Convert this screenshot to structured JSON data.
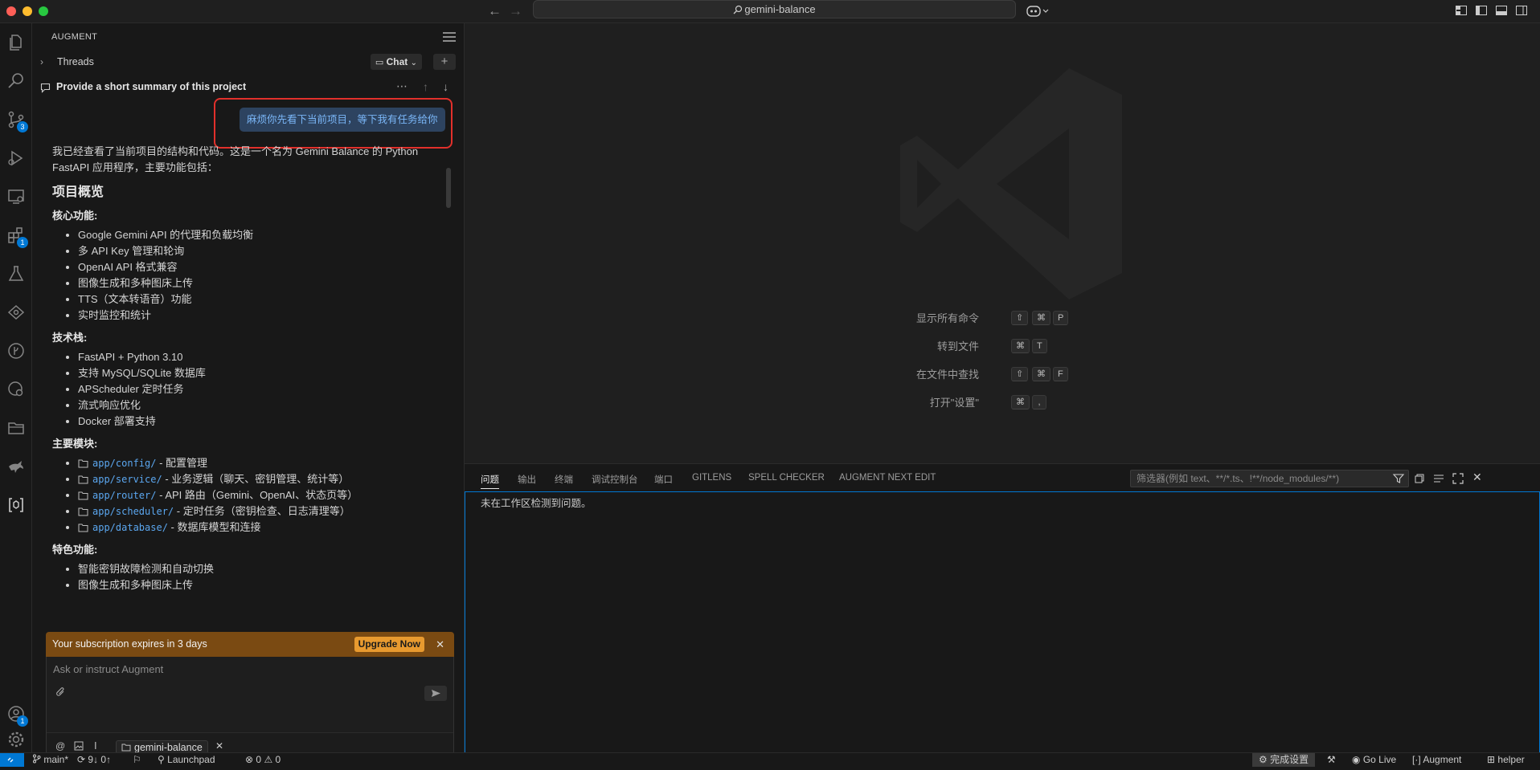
{
  "window": {
    "search_text": "gemini-balance"
  },
  "activity_bar": {
    "source_control_badge": "3",
    "extensions_badge": "1",
    "accounts_badge": "1"
  },
  "sidebar": {
    "title": "AUGMENT",
    "threads_label": "Threads",
    "chat_label": "Chat",
    "thread_title": "Provide a short summary of this project",
    "user_message": "麻烦你先看下当前项目，等下我有任务给你",
    "response": {
      "intro": "我已经查看了当前项目的结构和代码。这是一个名为 Gemini Balance 的 Python FastAPI 应用程序，主要功能包括：",
      "heading": "项目概览",
      "core_title": "核心功能:",
      "core_items": [
        "Google Gemini API 的代理和负载均衡",
        "多 API Key 管理和轮询",
        "OpenAI API 格式兼容",
        "图像生成和多种图床上传",
        "TTS（文本转语音）功能",
        "实时监控和统计"
      ],
      "tech_title": "技术栈:",
      "tech_items": [
        "FastAPI + Python 3.10",
        "支持 MySQL/SQLite 数据库",
        "APScheduler 定时任务",
        "流式响应优化",
        "Docker 部署支持"
      ],
      "modules_title": "主要模块:",
      "modules": [
        {
          "path": "app/config/",
          "desc": " - 配置管理"
        },
        {
          "path": "app/service/",
          "desc": " - 业务逻辑（聊天、密钥管理、统计等）"
        },
        {
          "path": "app/router/",
          "desc": " - API 路由（Gemini、OpenAI、状态页等）"
        },
        {
          "path": "app/scheduler/",
          "desc": " - 定时任务（密钥检查、日志清理等）"
        },
        {
          "path": "app/database/",
          "desc": " - 数据库模型和连接"
        }
      ],
      "features_title": "特色功能:",
      "features_items": [
        "智能密钥故障检测和自动切换",
        "图像生成和多种图床上传"
      ]
    },
    "subscription_text": "Your subscription expires in 3 days",
    "upgrade_label": "Upgrade Now",
    "input_placeholder": "Ask or instruct Augment",
    "context_chip": "gemini-balance"
  },
  "editor": {
    "shortcuts": [
      {
        "label": "显示所有命令",
        "keys": [
          "⇧",
          "⌘",
          "P"
        ]
      },
      {
        "label": "转到文件",
        "keys": [
          "⌘",
          "T"
        ]
      },
      {
        "label": "在文件中查找",
        "keys": [
          "⇧",
          "⌘",
          "F"
        ]
      },
      {
        "label": "打开\"设置\"",
        "keys": [
          "⌘",
          ","
        ]
      }
    ]
  },
  "panel": {
    "tabs": [
      "问题",
      "输出",
      "终端",
      "调试控制台",
      "端口",
      "GITLENS",
      "SPELL CHECKER",
      "AUGMENT NEXT EDIT"
    ],
    "filter_placeholder": "筛选器(例如 text、**/*.ts、!**/node_modules/**)",
    "message": "未在工作区检测到问题。"
  },
  "statusbar": {
    "branch": "main*",
    "sync": "9↓ 0↑",
    "launchpad": "Launchpad",
    "errors": "0",
    "warnings": "0",
    "setup": "完成设置",
    "golive": "Go Live",
    "augment": "Augment",
    "helper": "helper"
  },
  "colors": {
    "accent": "#0078d4",
    "highlight_box": "#e2302b",
    "upgrade": "#e89a2f"
  }
}
